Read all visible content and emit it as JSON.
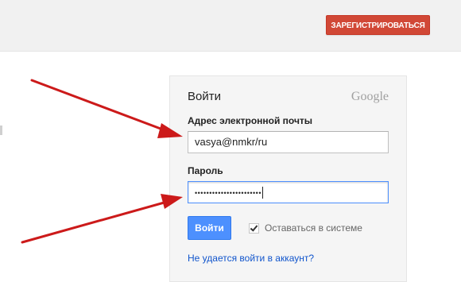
{
  "header": {
    "signup_label": "ЗАРЕГИСТРИРОВАТЬСЯ"
  },
  "signin": {
    "title": "Войти",
    "logo_text": "Google",
    "email_label": "Адрес электронной почты",
    "email_value": "vasya@nmkr/ru",
    "password_label": "Пароль",
    "password_mask": "•••••••••••••••••••••••",
    "signin_button": "Войти",
    "stay_signed_in_label": "Оставаться в системе",
    "stay_signed_in_checked": true,
    "help_link": "Не удается войти в аккаунт?"
  },
  "colors": {
    "signup_button": "#d14836",
    "signin_button": "#4d90fe",
    "link": "#1155cc",
    "annotation_arrow": "#cc1a1a"
  },
  "annotations": {
    "arrows": [
      "red-arrow-to-email-field",
      "red-arrow-to-password-field"
    ]
  }
}
